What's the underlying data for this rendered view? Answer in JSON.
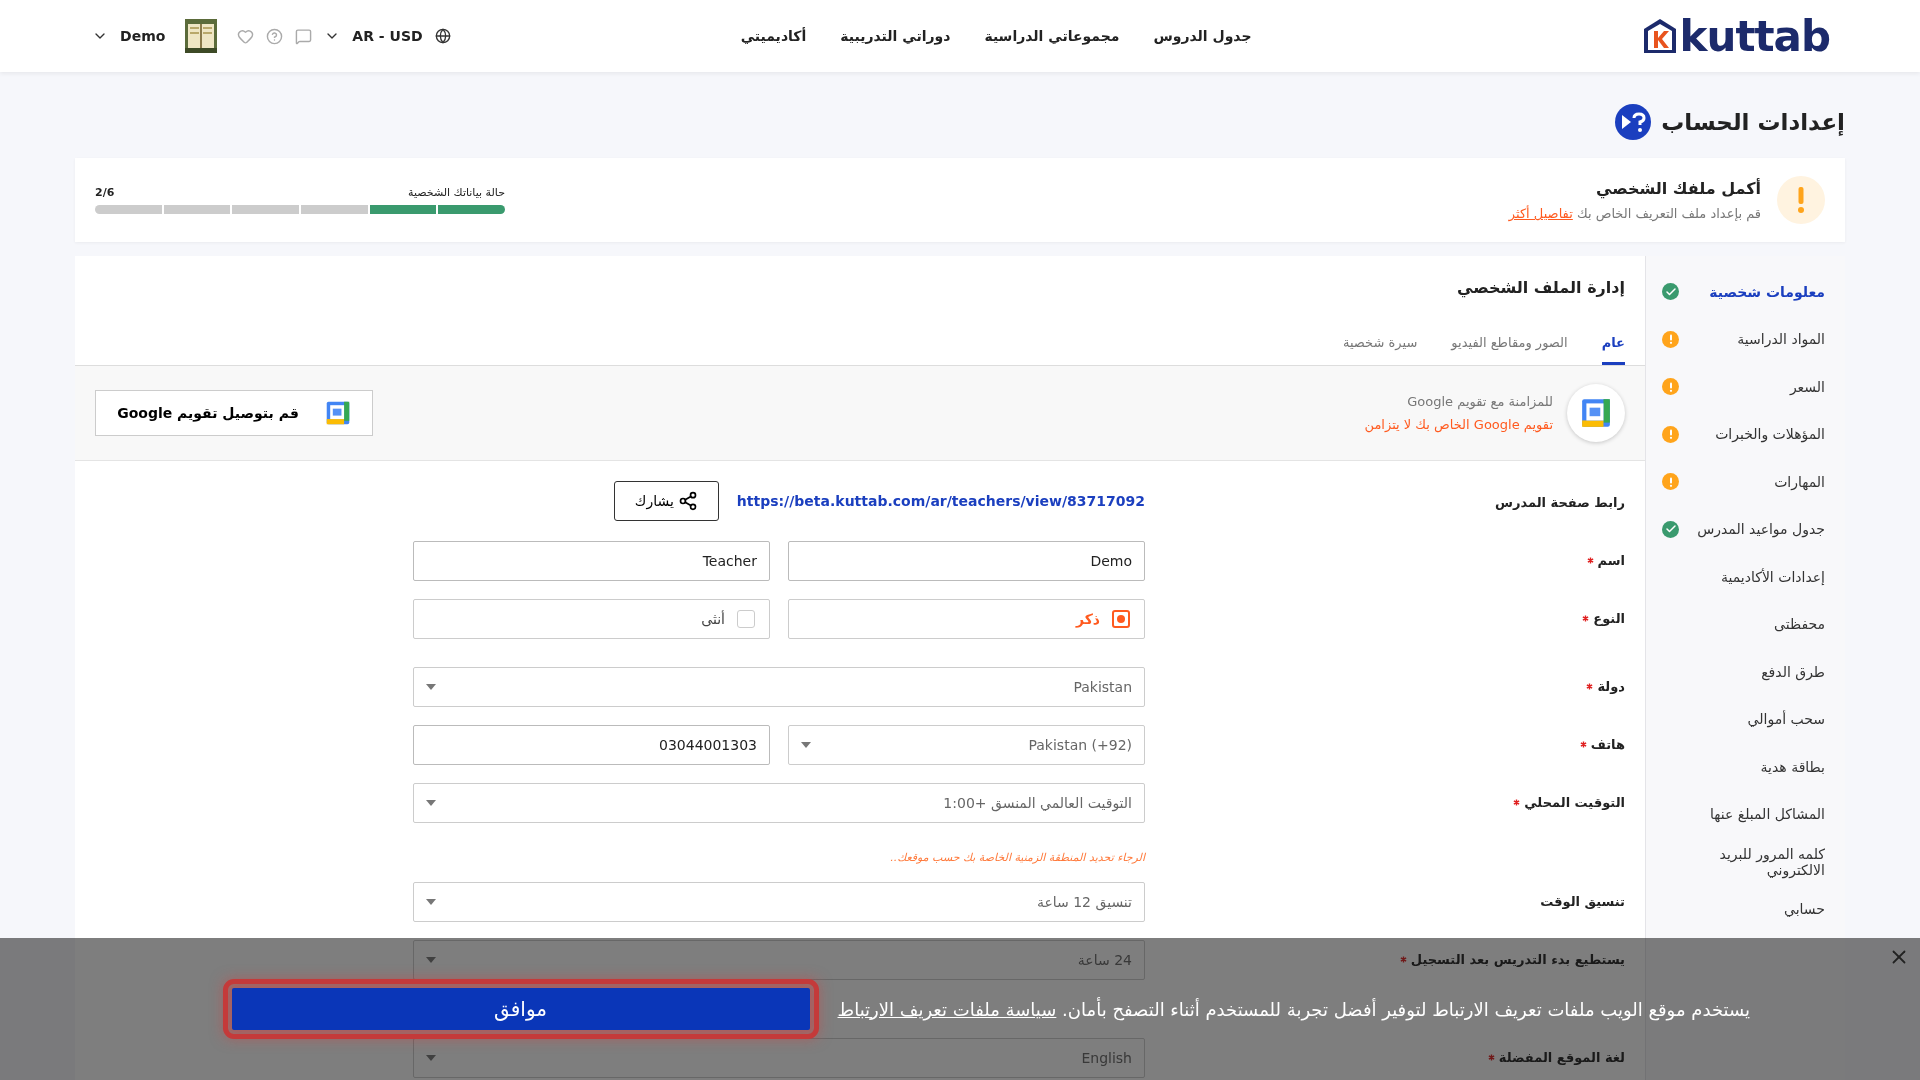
{
  "header": {
    "logo": "kuttab",
    "nav": [
      "جدول الدروس",
      "مجموعاتي الدراسية",
      "دوراتي التدريبية",
      "أكاديميتي"
    ],
    "locale": "AR - USD",
    "user": "Demo"
  },
  "page_title": "إعدادات الحساب",
  "profile_card": {
    "title": "أكمل ملفك الشخصي",
    "subtitle": "قم بإعداد ملف التعريف الخاص بك",
    "link": "تفاصيل أكثر",
    "progress_label": "حالة بياناتك الشخصية",
    "progress_count": "2/6",
    "level": 0.3333
  },
  "sidebar": [
    {
      "label": "معلومات شخصية",
      "kind": "complete",
      "selected": true
    },
    {
      "label": "المواد الدراسية",
      "kind": "warning",
      "selected": false
    },
    {
      "label": "السعر",
      "kind": "warning",
      "selected": false
    },
    {
      "label": "المؤهلات والخبرات",
      "kind": "warning",
      "selected": false
    },
    {
      "label": "المهارات",
      "kind": "warning",
      "selected": false
    },
    {
      "label": "جدول مواعيد المدرس",
      "kind": "complete",
      "selected": false
    },
    {
      "label": "إعدادات الأكاديمية",
      "kind": "plain",
      "selected": false
    },
    {
      "label": "محفظتى",
      "kind": "plain",
      "selected": false
    },
    {
      "label": "طرق الدفع",
      "kind": "plain",
      "selected": false
    },
    {
      "label": "سحب أموالي",
      "kind": "plain",
      "selected": false
    },
    {
      "label": "بطاقة هدية",
      "kind": "plain",
      "selected": false
    },
    {
      "label": "المشاكل المبلغ عنها",
      "kind": "plain",
      "selected": false
    },
    {
      "label": "كلمه المرور للبريد الالكتروني",
      "kind": "plain",
      "selected": false
    },
    {
      "label": "حسابي",
      "kind": "plain",
      "selected": false
    }
  ],
  "panel_title": "إدارة الملف الشخصي",
  "tabs": [
    {
      "label": "عام",
      "selected": true
    },
    {
      "label": "الصور ومقاطع الفيديو",
      "selected": false
    },
    {
      "label": "سيرة شخصية",
      "selected": false
    }
  ],
  "google_sync": {
    "title": "للمزامنة مع تقويم Google",
    "warning": "تقويم Google الخاص بك لا يتزامن",
    "button": "قم بتوصيل تقويم Google"
  },
  "form": [
    {
      "kind": "link",
      "label": "رابط صفحة المدرس",
      "required": false,
      "url": "https://beta.kuttab.com/ar/teachers/view/83717092",
      "button": "يشارك"
    },
    {
      "kind": "inputs",
      "label": "اسم",
      "required": true,
      "values": [
        "Demo",
        "Teacher"
      ]
    },
    {
      "kind": "gender",
      "label": "النوع",
      "required": true,
      "options": [
        {
          "label": "ذكر",
          "selected": true
        },
        {
          "label": "أنثى",
          "selected": false
        }
      ]
    },
    {
      "kind": "select",
      "label": "دولة",
      "required": true,
      "value": "Pakistan"
    },
    {
      "kind": "phone",
      "label": "هاتف",
      "required": true,
      "code": "Pakistan (+92)",
      "value": "03044001303"
    },
    {
      "kind": "select",
      "label": "التوقيت المحلي",
      "required": true,
      "value": "التوقيت العالمي المنسق +1:00",
      "hint": "الرجاء تحديد المنطقة الزمنية الخاصة بك حسب موقعك.."
    },
    {
      "kind": "select",
      "label": "تنسيق الوقت",
      "required": false,
      "value": "تنسيق 12 ساعة"
    },
    {
      "kind": "select",
      "label": "يستطيع بدء التدريس بعد التسجيل",
      "required": true,
      "value": "24 ساعة"
    },
    {
      "kind": "select",
      "label": "لغة الموقع المفضلة",
      "required": true,
      "value": "English"
    }
  ],
  "cookie_banner": {
    "text": "يستخدم موقع الويب ملفات تعريف الارتباط لتوفير أفضل تجربة للمستخدم أثناء التصفح بأمان.",
    "link": "سياسة ملفات تعريف الارتباط",
    "button": "موافق"
  }
}
